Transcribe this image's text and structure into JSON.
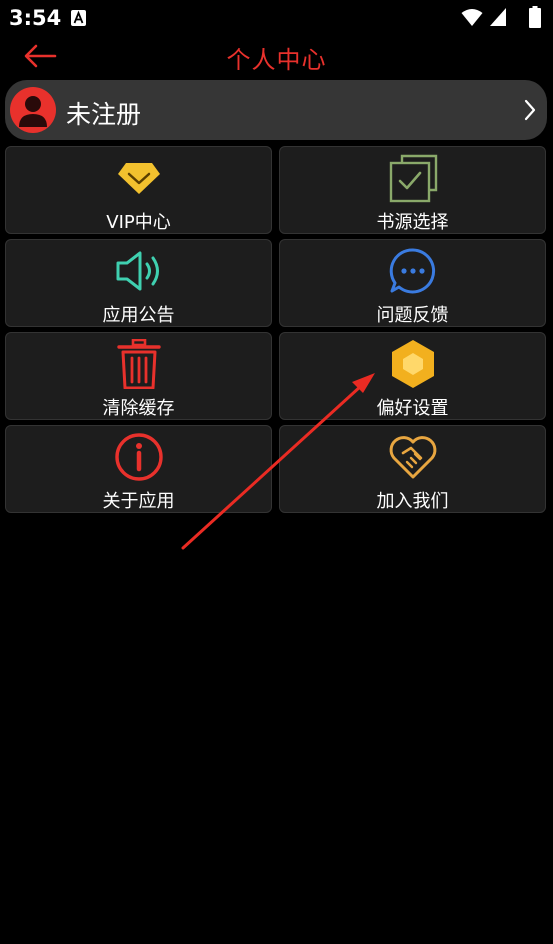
{
  "status": {
    "time": "3:54",
    "icons": [
      "accessibility-a-icon",
      "wifi-icon",
      "signal-icon",
      "battery-icon"
    ]
  },
  "header": {
    "title": "个人中心",
    "back_icon": "back-arrow-icon",
    "accent_color": "#e8312c"
  },
  "user": {
    "name": "未注册",
    "avatar_icon": "user-avatar-icon"
  },
  "menu": {
    "items": [
      {
        "label": "VIP中心",
        "icon": "diamond-icon"
      },
      {
        "label": "书源选择",
        "icon": "checkbox-stack-icon"
      },
      {
        "label": "应用公告",
        "icon": "speaker-icon"
      },
      {
        "label": "问题反馈",
        "icon": "chat-bubble-icon"
      },
      {
        "label": "清除缓存",
        "icon": "trash-icon"
      },
      {
        "label": "偏好设置",
        "icon": "hexagon-settings-icon"
      },
      {
        "label": "关于应用",
        "icon": "info-icon"
      },
      {
        "label": "加入我们",
        "icon": "handshake-heart-icon"
      }
    ]
  }
}
